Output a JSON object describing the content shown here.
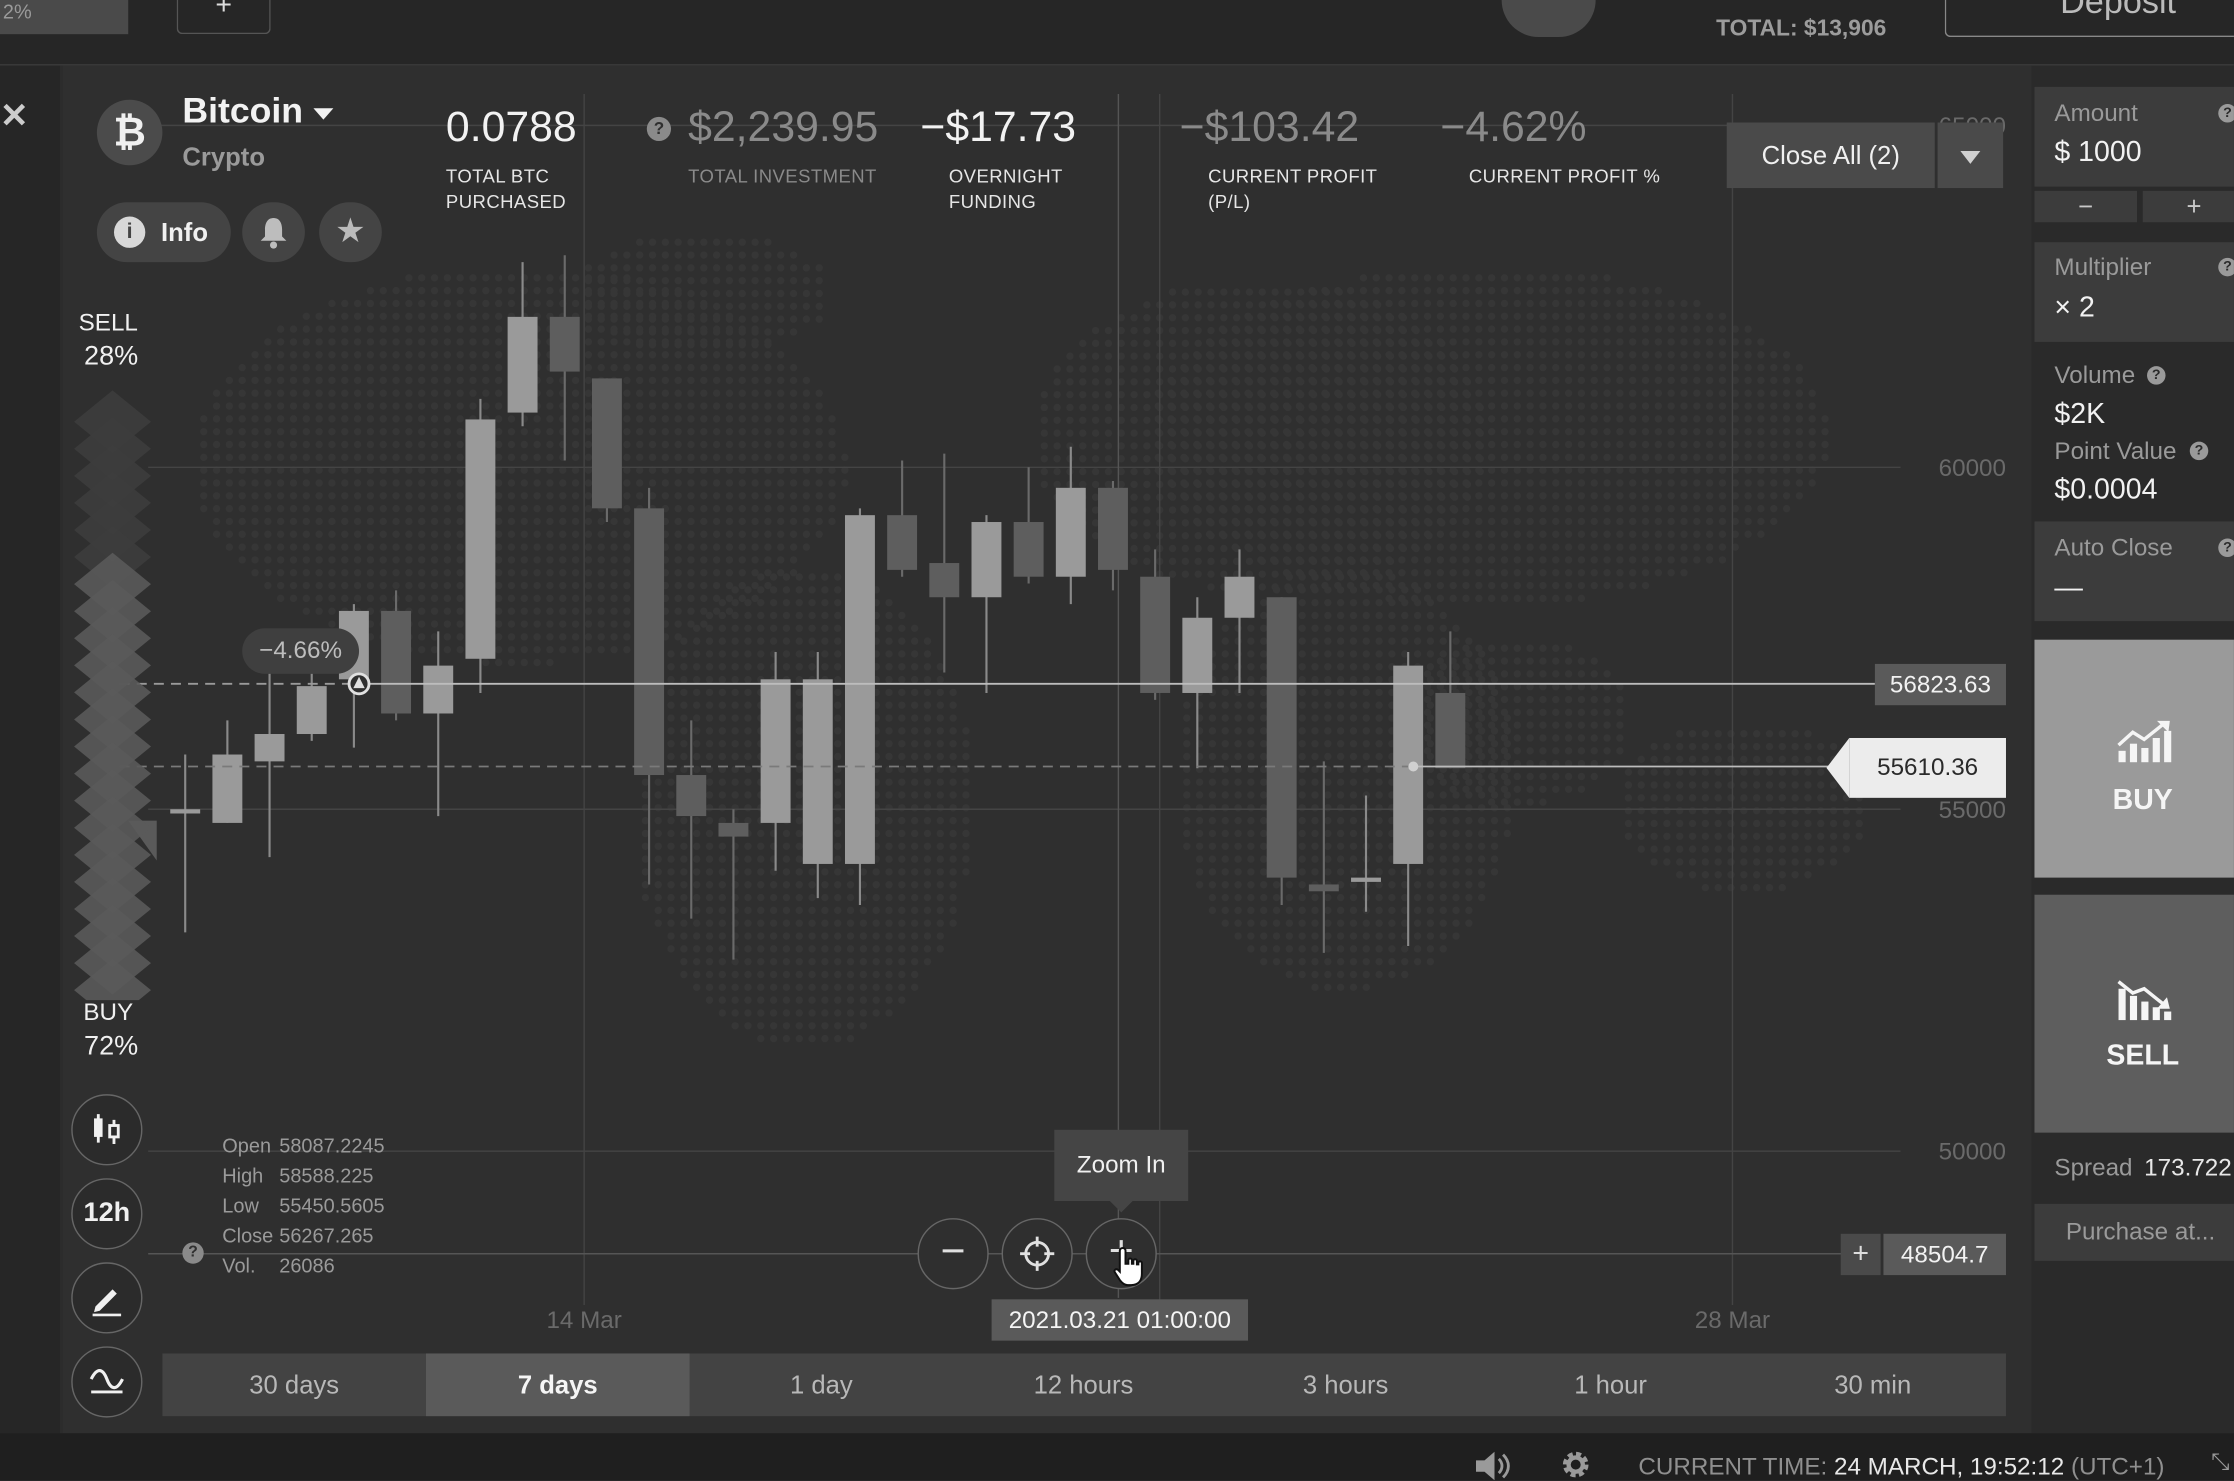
{
  "topbar": {
    "left_pct": "2%",
    "total": "TOTAL: $13,906",
    "deposit": "Deposit"
  },
  "asset": {
    "name": "Bitcoin",
    "type": "Crypto",
    "info_label": "Info",
    "logo_glyph": "₿"
  },
  "stats": [
    {
      "value": "0.0788",
      "label_1": "TOTAL BTC",
      "label_2": "PURCHASED"
    },
    {
      "value": "$2,239.95",
      "label_1": "TOTAL INVESTMENT",
      "label_2": ""
    },
    {
      "value": "−$17.73",
      "label_1": "OVERNIGHT",
      "label_2": "FUNDING"
    },
    {
      "value": "−$103.42",
      "label_1": "CURRENT PROFIT",
      "label_2": "(P/L)"
    },
    {
      "value": "−4.62%",
      "label_1": "CURRENT PROFIT %",
      "label_2": ""
    }
  ],
  "close_all": "Close All (2)",
  "sentiment": {
    "sell_label": "SELL",
    "sell_pct": "28%",
    "buy_label": "BUY",
    "buy_pct": "72%",
    "buy_share": 0.72
  },
  "tools": {
    "interval": "12h"
  },
  "ohlc": {
    "open_label": "Open",
    "open": "58087.2245",
    "high_label": "High",
    "high": "58588.225",
    "low_label": "Low",
    "low": "55450.5605",
    "close_label": "Close",
    "close": "56267.265",
    "vol_label": "Vol.",
    "vol": "26086"
  },
  "chart_controls": {
    "zoom_in_tooltip": "Zoom In",
    "cursor_time": "2021.03.21 01:00:00",
    "open_position_pct": "−4.66%"
  },
  "price_tags": {
    "position": "56823.63",
    "current": "55610.36",
    "cursor": "48504.7"
  },
  "timeframes": [
    "30 days",
    "7 days",
    "1 day",
    "12 hours",
    "3 hours",
    "1 hour",
    "30 min"
  ],
  "active_timeframe": "7 days",
  "trade_panel": {
    "amount_label": "Amount",
    "amount_value": "$  1000",
    "minus": "−",
    "plus": "+",
    "multiplier_label": "Multiplier",
    "multiplier_value": "× 2",
    "volume_label": "Volume",
    "volume_value": "$2K",
    "point_value_label": "Point Value",
    "point_value_value": "$0.0004",
    "auto_close_label": "Auto Close",
    "auto_close_value": "—",
    "buy_label": "BUY",
    "sell_label": "SELL",
    "spread_label": "Spread",
    "spread_value": "173.722",
    "purchase_label": "Purchase at..."
  },
  "status_bar": {
    "time_label": "CURRENT TIME:",
    "time_value": "24 MARCH, 19:52:12",
    "tz": "(UTC+1)"
  },
  "chart_data": {
    "type": "candlestick",
    "ylim": [
      47500,
      65500
    ],
    "y_ticks": [
      50000,
      55000,
      60000,
      65000
    ],
    "x_ticks": [
      "14 Mar",
      "28 Mar"
    ],
    "grid": true,
    "candles": [
      {
        "o": 55000,
        "c": 55000,
        "h": 55800,
        "l": 53200
      },
      {
        "o": 54800,
        "c": 55800,
        "h": 56300,
        "l": 54800
      },
      {
        "o": 55700,
        "c": 56100,
        "h": 57200,
        "l": 54300
      },
      {
        "o": 56100,
        "c": 56800,
        "h": 57600,
        "l": 56000
      },
      {
        "o": 56900,
        "c": 57900,
        "h": 58000,
        "l": 55900
      },
      {
        "o": 57900,
        "c": 56400,
        "h": 58200,
        "l": 56300
      },
      {
        "o": 56400,
        "c": 57100,
        "h": 57600,
        "l": 54900
      },
      {
        "o": 57200,
        "c": 60700,
        "h": 61000,
        "l": 56700
      },
      {
        "o": 60800,
        "c": 62200,
        "h": 63000,
        "l": 60600
      },
      {
        "o": 62200,
        "c": 61400,
        "h": 63100,
        "l": 60100
      },
      {
        "o": 61300,
        "c": 59400,
        "h": 61300,
        "l": 59200
      },
      {
        "o": 59400,
        "c": 55500,
        "h": 59700,
        "l": 53900
      },
      {
        "o": 55500,
        "c": 54900,
        "h": 56300,
        "l": 53400
      },
      {
        "o": 54800,
        "c": 54600,
        "h": 55000,
        "l": 52800
      },
      {
        "o": 54800,
        "c": 56900,
        "h": 57300,
        "l": 54100
      },
      {
        "o": 54200,
        "c": 56900,
        "h": 57300,
        "l": 53700
      },
      {
        "o": 54200,
        "c": 59300,
        "h": 59400,
        "l": 53600
      },
      {
        "o": 59300,
        "c": 58500,
        "h": 60100,
        "l": 58400
      },
      {
        "o": 58600,
        "c": 58100,
        "h": 60200,
        "l": 57000
      },
      {
        "o": 58100,
        "c": 59200,
        "h": 59300,
        "l": 56700
      },
      {
        "o": 59200,
        "c": 58400,
        "h": 60000,
        "l": 58300
      },
      {
        "o": 58400,
        "c": 59700,
        "h": 60300,
        "l": 58000
      },
      {
        "o": 59700,
        "c": 58500,
        "h": 59800,
        "l": 58200
      },
      {
        "o": 58400,
        "c": 56700,
        "h": 58800,
        "l": 56600
      },
      {
        "o": 56700,
        "c": 57800,
        "h": 58100,
        "l": 55600
      },
      {
        "o": 57800,
        "c": 58400,
        "h": 58800,
        "l": 56700
      },
      {
        "o": 58100,
        "c": 54000,
        "h": 58100,
        "l": 53600
      },
      {
        "o": 53900,
        "c": 53800,
        "h": 55700,
        "l": 52900
      },
      {
        "o": 54000,
        "c": 54000,
        "h": 55200,
        "l": 53500
      },
      {
        "o": 54200,
        "c": 57100,
        "h": 57300,
        "l": 53000
      },
      {
        "o": 56700,
        "c": 55600,
        "h": 57600,
        "l": 55600
      }
    ]
  }
}
